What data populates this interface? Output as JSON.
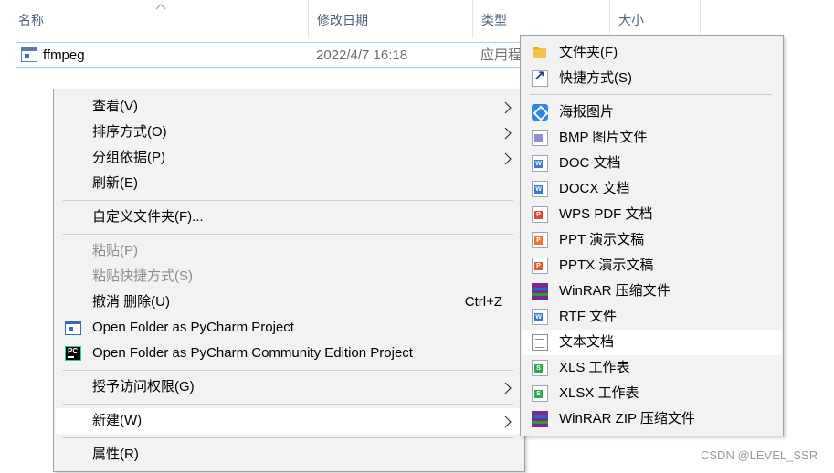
{
  "columns": {
    "name": "名称",
    "date_modified": "修改日期",
    "type": "类型",
    "size": "大小"
  },
  "file": {
    "name": "ffmpeg",
    "date": "2022/4/7 16:18",
    "type": "应用程"
  },
  "context_menu": {
    "view": "查看(V)",
    "sort_by": "排序方式(O)",
    "group_by": "分组依据(P)",
    "refresh": "刷新(E)",
    "customize_folder": "自定义文件夹(F)...",
    "paste": "粘贴(P)",
    "paste_shortcut": "粘贴快捷方式(S)",
    "undo_delete": "撤消 删除(U)",
    "undo_shortcut": "Ctrl+Z",
    "open_pycharm": "Open Folder as PyCharm Project",
    "open_pycharm_ce": "Open Folder as PyCharm Community Edition Project",
    "grant_access": "授予访问权限(G)",
    "new": "新建(W)",
    "properties": "属性(R)"
  },
  "new_submenu": [
    {
      "label": "文件夹(F)",
      "icon": "folder-icon"
    },
    {
      "label": "快捷方式(S)",
      "icon": "shortcut-icon"
    },
    {
      "label": "海报图片",
      "icon": "poster-icon"
    },
    {
      "label": "BMP 图片文件",
      "icon": "bmp-icon"
    },
    {
      "label": "DOC 文档",
      "icon": "doc-icon"
    },
    {
      "label": "DOCX 文档",
      "icon": "docx-icon"
    },
    {
      "label": "WPS PDF 文档",
      "icon": "pdf-icon"
    },
    {
      "label": "PPT 演示文稿",
      "icon": "ppt-icon"
    },
    {
      "label": "PPTX 演示文稿",
      "icon": "pptx-icon"
    },
    {
      "label": "WinRAR 压缩文件",
      "icon": "winrar-icon"
    },
    {
      "label": "RTF 文件",
      "icon": "rtf-icon"
    },
    {
      "label": "文本文档",
      "icon": "text-document-icon"
    },
    {
      "label": "XLS 工作表",
      "icon": "xls-icon"
    },
    {
      "label": "XLSX 工作表",
      "icon": "xlsx-icon"
    },
    {
      "label": "WinRAR ZIP 压缩文件",
      "icon": "winrar-zip-icon"
    }
  ],
  "watermark": "CSDN @LEVEL_SSR",
  "colors": {
    "menu_bg": "#f2f2f2",
    "hover_bg": "#ffffff",
    "selection_border": "#99d1ff",
    "header_text": "#4c607a",
    "disabled_text": "#8c8c8c"
  }
}
